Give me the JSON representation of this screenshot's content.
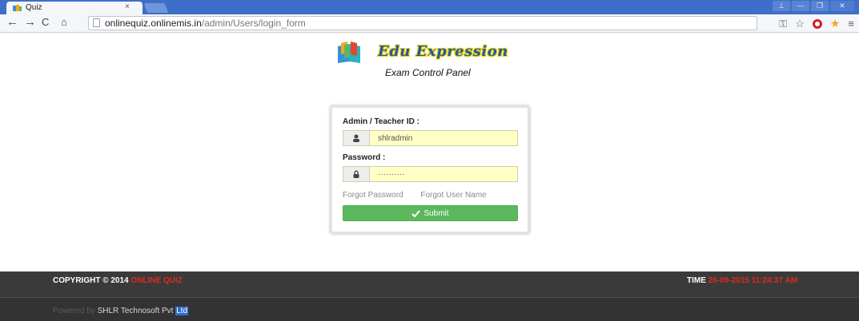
{
  "browser": {
    "tab_title": "Quiz",
    "tab_close": "×",
    "url_host": "onlinequiz.onlinemis.in",
    "url_path": "/admin/Users/login_form",
    "window_buttons": [
      "⊥",
      "—",
      "❐",
      "✕"
    ]
  },
  "header": {
    "logo_text": "Edu Expression",
    "subtitle": "Exam Control Panel"
  },
  "login": {
    "id_label": "Admin / Teacher ID :",
    "id_value": "shlradmin",
    "password_label": "Password :",
    "password_value": "··········",
    "forgot_password": "Forgot Password",
    "forgot_username": "Forgot User Name",
    "submit_label": "Submit"
  },
  "footer": {
    "copyright_prefix": "COPYRIGHT © 2014",
    "copyright_brand": "ONLINE QUIZ",
    "time_label": "TIME",
    "time_value": "26-09-2015 11:24:37 AM",
    "powered_by": "Powered by",
    "company": "SHLR Technosoft Pvt",
    "company_suffix": "Ltd"
  },
  "colors": {
    "tabstrip": "#3d6fc9",
    "submit": "#5cb85c",
    "input_fill": "#ffffc6",
    "footer": "#3a3a3a",
    "accent_red": "#e02a1f"
  }
}
